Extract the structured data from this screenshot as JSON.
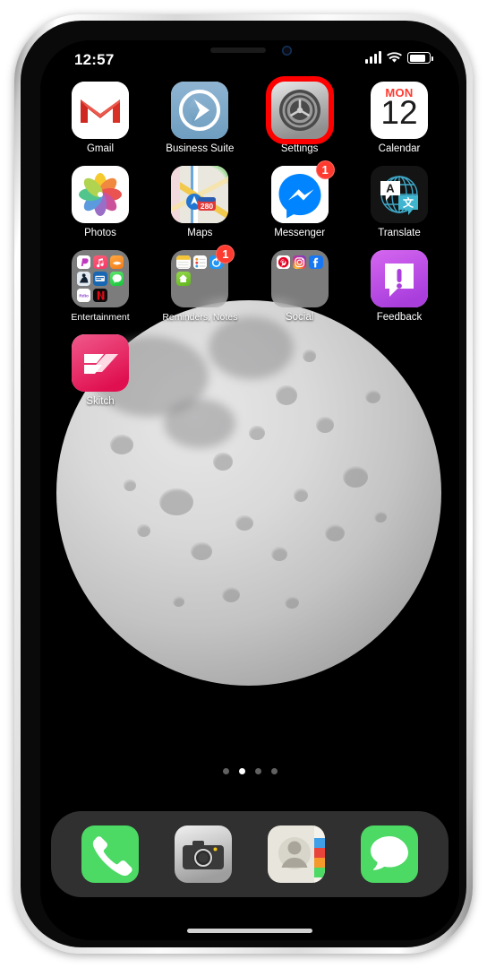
{
  "device": {
    "name": "iPhone",
    "frame_color": "#e9e9e9"
  },
  "status_bar": {
    "time": "12:57",
    "signal_icon": "cellular-signal-icon",
    "wifi_icon": "wifi-icon",
    "battery_icon": "battery-icon",
    "battery_level_percent": 72
  },
  "home_screen": {
    "wallpaper": "moon-wallpaper",
    "highlight_color": "#ff0000",
    "highlighted_app": "Settings",
    "rows": [
      {
        "apps": [
          {
            "label": "Gmail",
            "icon": "gmail-icon",
            "type": "app",
            "badge": null,
            "highlighted": false
          },
          {
            "label": "Business Suite",
            "icon": "business-suite-icon",
            "type": "app",
            "badge": null,
            "highlighted": false
          },
          {
            "label": "Settings",
            "icon": "settings-gear-icon",
            "type": "app",
            "badge": null,
            "highlighted": true
          },
          {
            "label": "Calendar",
            "icon": "calendar-icon",
            "type": "app",
            "badge": null,
            "highlighted": false,
            "calendar_weekday": "MON",
            "calendar_day": "12"
          }
        ]
      },
      {
        "apps": [
          {
            "label": "Photos",
            "icon": "photos-icon",
            "type": "app",
            "badge": null,
            "highlighted": false
          },
          {
            "label": "Maps",
            "icon": "maps-icon",
            "type": "app",
            "badge": null,
            "highlighted": false,
            "route_shield": "280"
          },
          {
            "label": "Messenger",
            "icon": "messenger-icon",
            "type": "app",
            "badge": "1",
            "highlighted": false
          },
          {
            "label": "Translate",
            "icon": "translate-icon",
            "type": "app",
            "badge": null,
            "highlighted": false,
            "glyph_a": "A",
            "glyph_cjk": "文"
          }
        ]
      },
      {
        "apps": [
          {
            "label": "Entertainment",
            "icon": "folder-icon",
            "type": "folder",
            "badge": null,
            "highlighted": false
          },
          {
            "label": "Reminders, Notes",
            "icon": "folder-icon",
            "type": "folder",
            "badge": "1",
            "highlighted": false
          },
          {
            "label": "Social",
            "icon": "folder-icon",
            "type": "folder",
            "badge": null,
            "highlighted": false
          },
          {
            "label": "Feedback",
            "icon": "feedback-icon",
            "type": "app",
            "badge": null,
            "highlighted": false
          }
        ]
      },
      {
        "apps": [
          {
            "label": "Skitch",
            "icon": "skitch-icon",
            "type": "app",
            "badge": null,
            "highlighted": false
          }
        ]
      }
    ],
    "page_dots": {
      "total": 4,
      "active_index": 1
    },
    "dock": [
      {
        "label": "Phone",
        "icon": "phone-handset-icon"
      },
      {
        "label": "Camera",
        "icon": "camera-icon"
      },
      {
        "label": "Contacts",
        "icon": "contacts-icon"
      },
      {
        "label": "Messages",
        "icon": "messages-bubble-icon"
      }
    ]
  }
}
